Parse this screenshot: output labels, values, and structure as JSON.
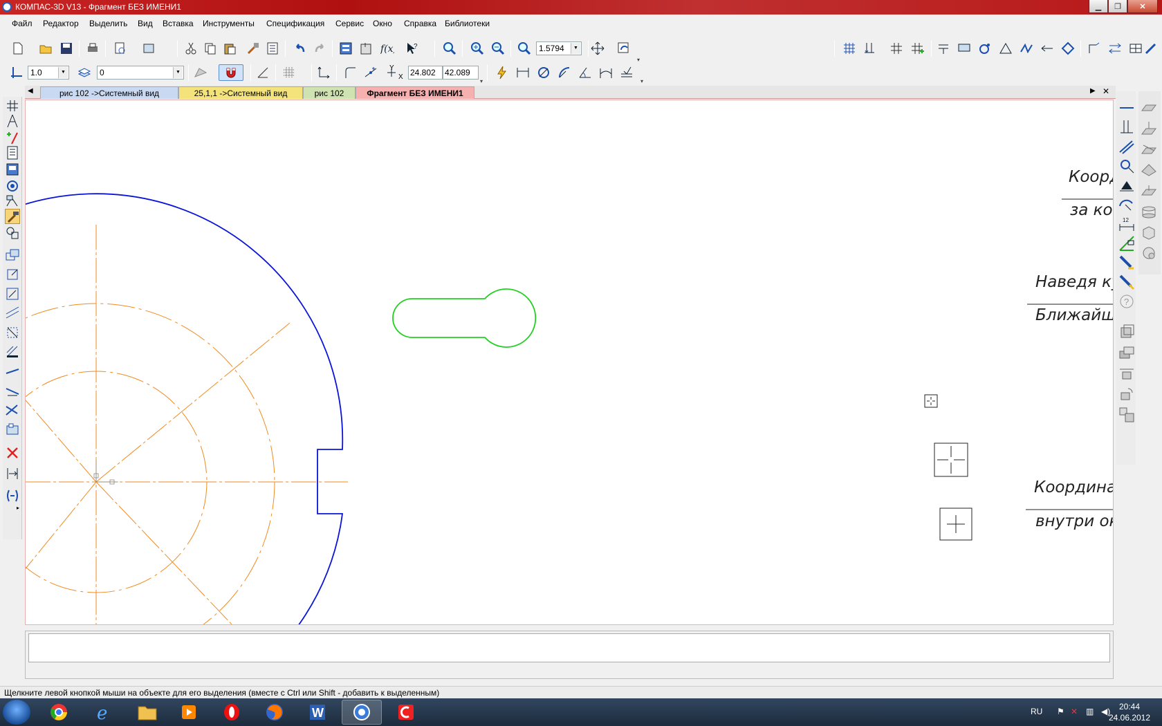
{
  "window": {
    "title": "КОМПАС-3D V13 - Фрагмент БЕЗ ИМЕНИ1"
  },
  "menu": [
    "Файл",
    "Редактор",
    "Выделить",
    "Вид",
    "Вставка",
    "Инструменты",
    "Спецификация",
    "Сервис",
    "Окно",
    "Справка",
    "Библиотеки"
  ],
  "toolbar": {
    "zoom_value": "1.5794",
    "line_scale": "1.0",
    "layer": "0",
    "coord_y": "24.802",
    "coord_x": "42.089",
    "coord_y_label": "Y",
    "coord_x_label": "X"
  },
  "tabs": [
    {
      "label": "рис 102 ->Системный вид",
      "color": "#c9d9f2"
    },
    {
      "label": "25,1,1 ->Системный вид",
      "color": "#f4e37a"
    },
    {
      "label": "рис 102",
      "color": "#cfe2b2"
    },
    {
      "label": "Фрагмент БЕЗ ИМЕНИ1",
      "color": "#f6b0b0"
    }
  ],
  "canvas_text": {
    "t1": "Коорд",
    "t2": "за кон",
    "t3": "Наведя кур",
    "t4": "Ближайшая",
    "t5": "Координат",
    "t6": "внутри окр"
  },
  "status": {
    "message": "Щелкните левой кнопкой мыши на объекте для его выделения (вместе с Ctrl или Shift - добавить к выделенным)"
  },
  "tray": {
    "lang": "RU",
    "time": "20:44",
    "date": "24.06.2012"
  },
  "colors": {
    "titlebar": "#c01818",
    "contour": "#0a14d8",
    "axis": "#f08a1e",
    "keyhole": "#22d022"
  }
}
